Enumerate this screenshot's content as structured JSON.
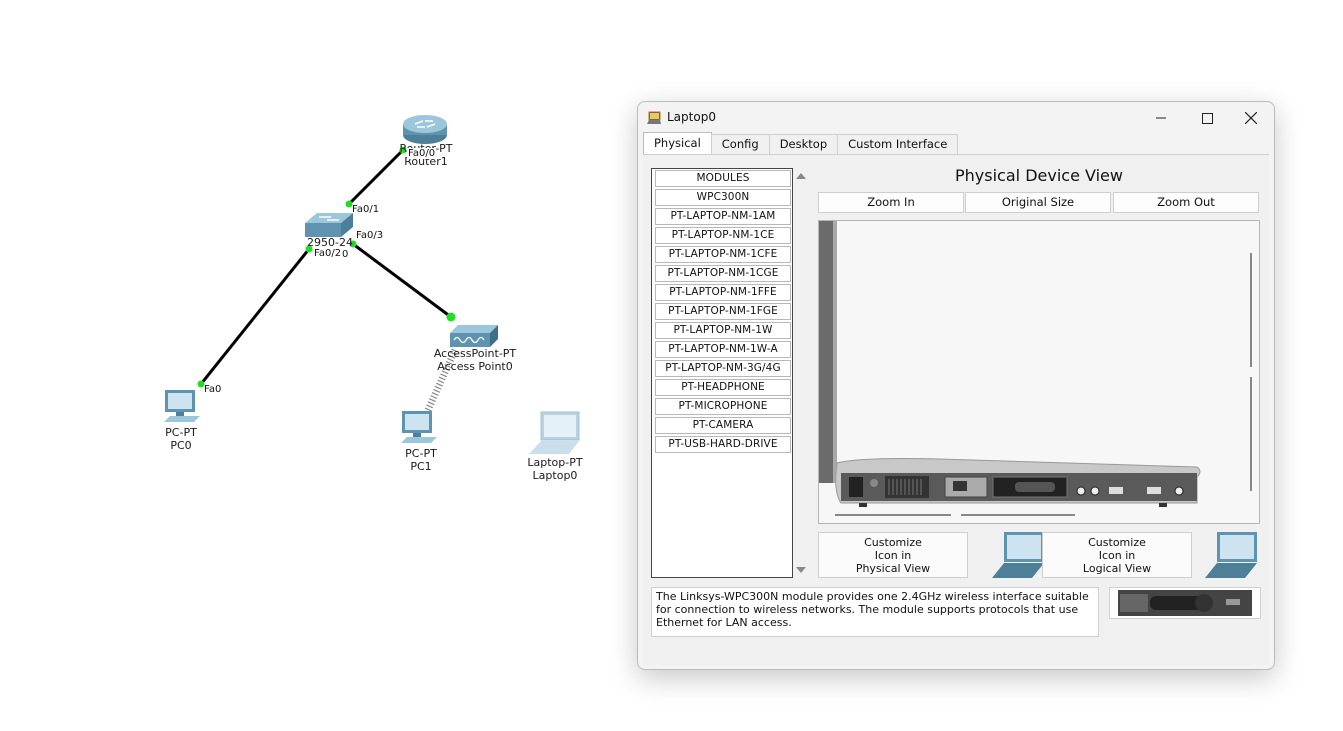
{
  "topology": {
    "devices": [
      {
        "key": "router",
        "model": "Router-PT",
        "name": "Router1"
      },
      {
        "key": "switch",
        "model": "2950-24",
        "name": "Switch0"
      },
      {
        "key": "ap",
        "model": "AccessPoint-PT",
        "name": "Access Point0"
      },
      {
        "key": "pc0",
        "model": "PC-PT",
        "name": "PC0"
      },
      {
        "key": "pc1",
        "model": "PC-PT",
        "name": "PC1"
      },
      {
        "key": "laptop",
        "model": "Laptop-PT",
        "name": "Laptop0"
      }
    ],
    "ports": {
      "router_fa00": "Fa0/0",
      "switch_fa01": "Fa0/1",
      "switch_fa03": "Fa0/3",
      "switch_fa02": "Fa0/2",
      "ap_port0": "0",
      "pc0_fa0": "Fa0"
    },
    "link_color": "#000000",
    "link_up_color": "#22dd22"
  },
  "window": {
    "title": "Laptop0",
    "tabs": [
      "Physical",
      "Config",
      "Desktop",
      "Custom Interface"
    ],
    "active_tab": "Physical",
    "modules_header": "MODULES",
    "modules": [
      "WPC300N",
      "PT-LAPTOP-NM-1AM",
      "PT-LAPTOP-NM-1CE",
      "PT-LAPTOP-NM-1CFE",
      "PT-LAPTOP-NM-1CGE",
      "PT-LAPTOP-NM-1FFE",
      "PT-LAPTOP-NM-1FGE",
      "PT-LAPTOP-NM-1W",
      "PT-LAPTOP-NM-1W-A",
      "PT-LAPTOP-NM-3G/4G",
      "PT-HEADPHONE",
      "PT-MICROPHONE",
      "PT-CAMERA",
      "PT-USB-HARD-DRIVE"
    ],
    "view_title": "Physical Device View",
    "zoom_in": "Zoom In",
    "original_size": "Original Size",
    "zoom_out": "Zoom Out",
    "customize_physical": [
      "Customize",
      "Icon in",
      "Physical View"
    ],
    "customize_logical": [
      "Customize",
      "Icon in",
      "Logical View"
    ],
    "description": "The Linksys-WPC300N module provides one 2.4GHz wireless interface suitable for connection to wireless networks. The module supports protocols that use Ethernet for LAN access."
  }
}
